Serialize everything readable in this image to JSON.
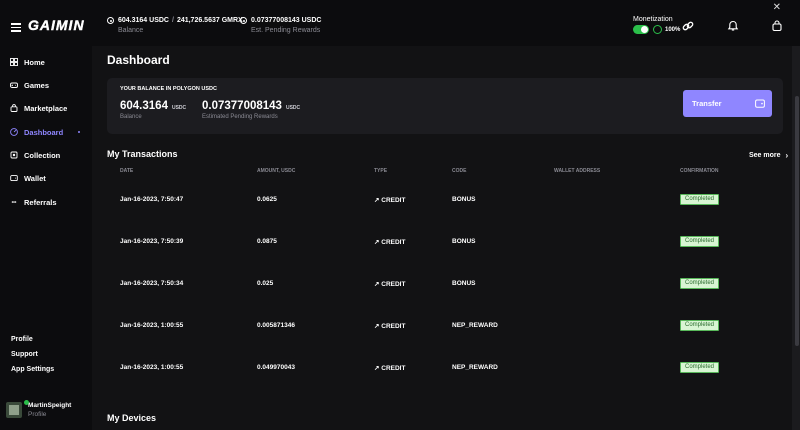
{
  "window": {
    "close_icon": "✕"
  },
  "brand": {
    "logo_text": "GAIMIN"
  },
  "header": {
    "balance_usdc": "604.3164 USDC",
    "balance_gmrx": "241,726.5637 GMRX",
    "balance_label": "Balance",
    "pending_usdc": "0.07377008143 USDC",
    "pending_label": "Est. Pending Rewards",
    "monetization_label": "Monetization",
    "monetization_percent": "100%",
    "monetization_on": true
  },
  "sidebar": {
    "items": [
      {
        "label": "Home",
        "icon": "grid-icon"
      },
      {
        "label": "Games",
        "icon": "gamepad-icon"
      },
      {
        "label": "Marketplace",
        "icon": "bag-icon"
      },
      {
        "label": "Dashboard",
        "icon": "dashboard-icon",
        "active": true
      },
      {
        "label": "Collection",
        "icon": "collection-icon"
      },
      {
        "label": "Wallet",
        "icon": "wallet-icon"
      },
      {
        "label": "Referrals",
        "icon": "referrals-icon"
      }
    ],
    "bottom_links": [
      "Profile",
      "Support",
      "App Settings"
    ],
    "user": {
      "name": "MartinSpeight",
      "subtitle": "Profile"
    }
  },
  "main": {
    "title": "Dashboard",
    "balance_card": {
      "heading": "YOUR BALANCE IN POLYGON USDC",
      "balance_value": "604.3164",
      "balance_unit": "USDC",
      "balance_label": "Balance",
      "pending_value": "0.07377008143",
      "pending_unit": "USDC",
      "pending_label": "Estimated Pending Rewards",
      "transfer_label": "Transfer"
    },
    "transactions": {
      "title": "My Transactions",
      "see_more": "See more",
      "columns": [
        "DATE",
        "AMOUNT, USDC",
        "TYPE",
        "CODE",
        "WALLET ADDRESS",
        "CONFIRMATION"
      ],
      "rows": [
        {
          "date": "Jan-16-2023, 7:50:47",
          "amount": "0.0625",
          "type": "↗ CREDIT",
          "code": "BONUS",
          "wallet": "",
          "confirmation": "Completed"
        },
        {
          "date": "Jan-16-2023, 7:50:39",
          "amount": "0.0875",
          "type": "↗ CREDIT",
          "code": "BONUS",
          "wallet": "",
          "confirmation": "Completed"
        },
        {
          "date": "Jan-16-2023, 7:50:34",
          "amount": "0.025",
          "type": "↗ CREDIT",
          "code": "BONUS",
          "wallet": "",
          "confirmation": "Completed"
        },
        {
          "date": "Jan-16-2023, 1:00:55",
          "amount": "0.005871346",
          "type": "↗ CREDIT",
          "code": "NEP_REWARD",
          "wallet": "",
          "confirmation": "Completed"
        },
        {
          "date": "Jan-16-2023, 1:00:55",
          "amount": "0.049970043",
          "type": "↗ CREDIT",
          "code": "NEP_REWARD",
          "wallet": "",
          "confirmation": "Completed"
        }
      ]
    },
    "devices": {
      "title": "My Devices"
    }
  },
  "colors": {
    "accent": "#8f86ff",
    "success_green": "#2bbf4a",
    "badge_bg": "#d8f5d3",
    "background": "#121214"
  }
}
